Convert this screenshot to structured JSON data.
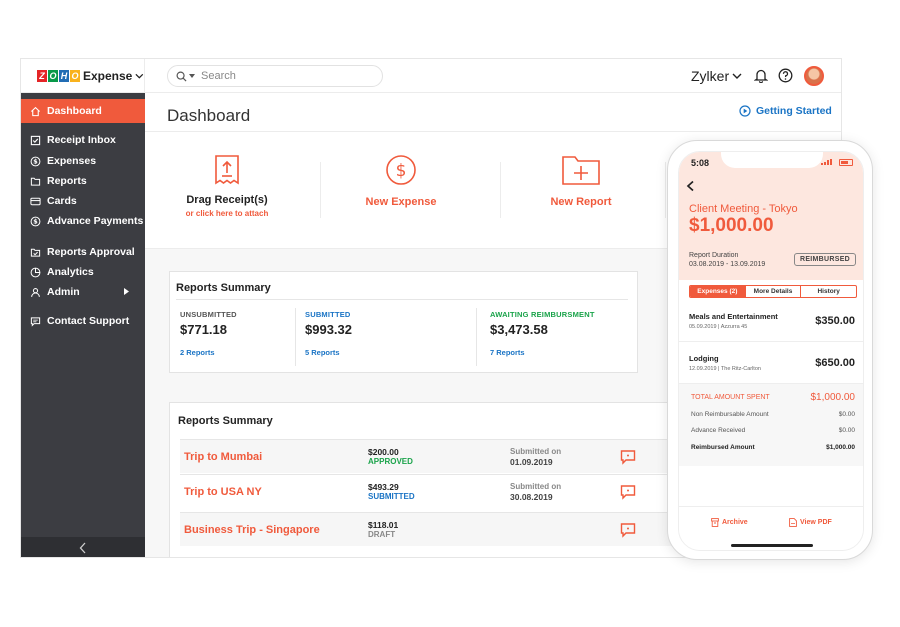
{
  "app": {
    "brand_name": "Expense",
    "zoho_letters": [
      "Z",
      "O",
      "H",
      "O"
    ],
    "zoho_colors": [
      "#e42527",
      "#089949",
      "#226db4",
      "#f9b21d"
    ],
    "accent_color": "#f05a3c",
    "link_color": "#1a74c5",
    "sidebar_color": "#3c3d42"
  },
  "topbar": {
    "search_placeholder": "Search",
    "org_name": "Zylker"
  },
  "sidebar": {
    "items": [
      {
        "label": "Dashboard",
        "icon": "home-icon",
        "active": true
      },
      {
        "label": "Receipt Inbox",
        "icon": "inbox-icon"
      },
      {
        "label": "Expenses",
        "icon": "dollar-circle-icon"
      },
      {
        "label": "Reports",
        "icon": "folder-icon"
      },
      {
        "label": "Cards",
        "icon": "card-icon"
      },
      {
        "label": "Advance Payments",
        "icon": "dollar-circle-icon"
      },
      {
        "label": "Reports Approval",
        "icon": "approval-icon"
      },
      {
        "label": "Analytics",
        "icon": "pie-chart-icon"
      },
      {
        "label": "Admin",
        "icon": "person-icon"
      },
      {
        "label": "Contact Support",
        "icon": "chat-icon"
      }
    ]
  },
  "main": {
    "title": "Dashboard",
    "getting_started": "Getting Started",
    "quick_actions": {
      "drag_title": "Drag Receipt(s)",
      "drag_sub": "or click here to attach",
      "new_expense": "New Expense",
      "new_report": "New Report"
    },
    "summary": {
      "title": "Reports Summary",
      "columns": [
        {
          "label": "UNSUBMITTED",
          "amount": "$771.18",
          "link": "2 Reports",
          "color": "#555555"
        },
        {
          "label": "SUBMITTED",
          "amount": "$993.32",
          "link": "5 Reports",
          "color": "#1a74c5"
        },
        {
          "label": "AWAITING REIMBURSMENT",
          "amount": "$3,473.58",
          "link": "7 Reports",
          "color": "#1aa34a"
        }
      ]
    },
    "reports": {
      "title": "Reports Summary",
      "rows": [
        {
          "name": "Trip to Mumbai",
          "amount": "$200.00",
          "status": "APPROVED",
          "status_color": "#1aa34a",
          "sub_label": "Submitted on",
          "sub_date": "01.09.2019"
        },
        {
          "name": "Trip to USA NY",
          "amount": "$493.29",
          "status": "SUBMITTED",
          "status_color": "#1a74c5",
          "sub_label": "Submitted on",
          "sub_date": "30.08.2019"
        },
        {
          "name": "Business Trip - Singapore",
          "amount": "$118.01",
          "status": "DRAFT",
          "status_color": "#888888",
          "sub_label": "",
          "sub_date": ""
        }
      ]
    }
  },
  "phone": {
    "time": "5:08",
    "report_title": "Client Meeting - Tokyo",
    "report_total": "$1,000.00",
    "duration_label": "Report Duration",
    "duration_value": "03.08.2019 - 13.09.2019",
    "status_badge": "REIMBURSED",
    "tabs": [
      "Expenses (2)",
      "More Details",
      "History"
    ],
    "expenses": [
      {
        "name": "Meals and Entertainment",
        "meta": "05.09.2019  |  Azzurra 45",
        "amount": "$350.00"
      },
      {
        "name": "Lodging",
        "meta": "12.09.2019  |  The Ritz-Carlton",
        "amount": "$650.00"
      }
    ],
    "totals": {
      "total_label": "TOTAL AMOUNT SPENT",
      "total_value": "$1,000.00",
      "non_reimb_label": "Non Reimbursable Amount",
      "non_reimb_value": "$0.00",
      "advance_label": "Advance Received",
      "advance_value": "$0.00",
      "reimbursed_label": "Reimbursed Amount",
      "reimbursed_value": "$1,000.00"
    },
    "footer": {
      "archive": "Archive",
      "view_pdf": "View PDF"
    }
  }
}
